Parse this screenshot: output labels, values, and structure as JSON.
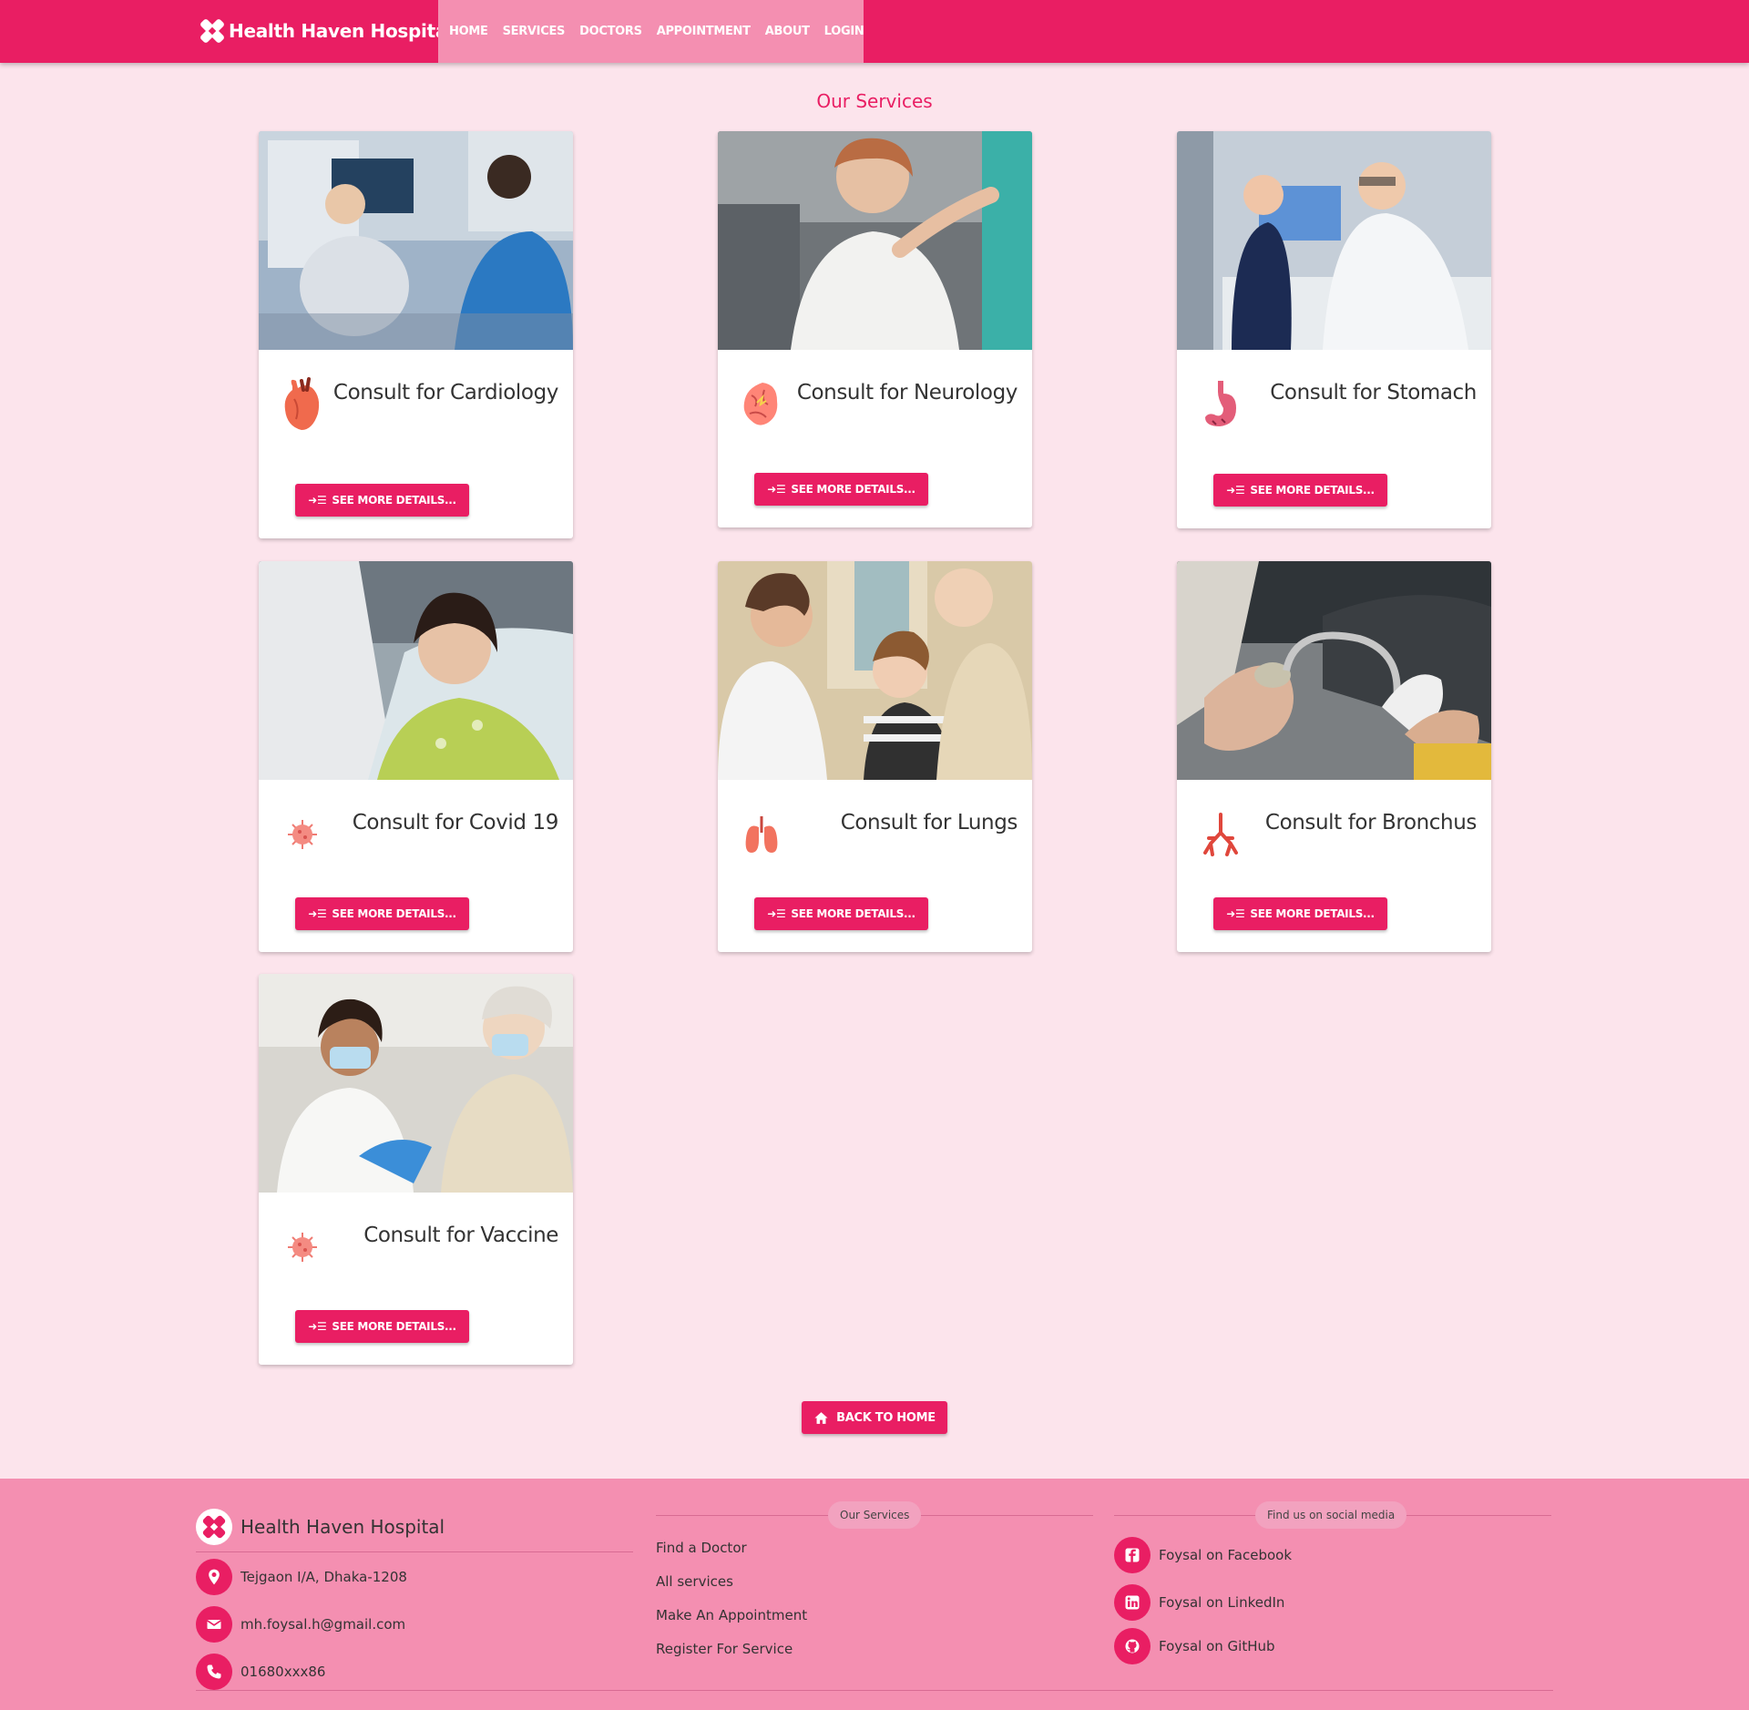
{
  "header": {
    "brand": "Health Haven Hospital",
    "nav": [
      "HOME",
      "SERVICES",
      "DOCTORS",
      "APPOINTMENT",
      "ABOUT",
      "LOGIN"
    ]
  },
  "page": {
    "title": "Our Services"
  },
  "services": [
    {
      "title": "Consult for Cardiology",
      "icon": "heart-icon",
      "button": "SEE MORE DETAILS..."
    },
    {
      "title": "Consult for Neurology",
      "icon": "brain-icon",
      "button": "SEE MORE DETAILS..."
    },
    {
      "title": "Consult for Stomach",
      "icon": "stomach-icon",
      "button": "SEE MORE DETAILS..."
    },
    {
      "title": "Consult for Covid 19",
      "icon": "virus-icon",
      "button": "SEE MORE DETAILS..."
    },
    {
      "title": "Consult for Lungs",
      "icon": "lungs-icon",
      "button": "SEE MORE DETAILS..."
    },
    {
      "title": "Consult for Bronchus",
      "icon": "bronchus-icon",
      "button": "SEE MORE DETAILS..."
    },
    {
      "title": "Consult for Vaccine",
      "icon": "virus-icon",
      "button": "SEE MORE DETAILS..."
    }
  ],
  "back_button": "BACK TO HOME",
  "footer": {
    "brand": "Health Haven Hospital",
    "address": "Tejgaon I/A, Dhaka-1208",
    "email": "mh.foysal.h@gmail.com",
    "phone": "01680xxx86",
    "services_heading": "Our Services",
    "services_links": [
      "Find a Doctor",
      "All services",
      "Make An Appointment",
      "Register For Service"
    ],
    "social_heading": "Find us on social media",
    "social_links": [
      "Foysal on Facebook",
      "Foysal on LinkedIn",
      "Foysal on GitHub"
    ]
  },
  "colors": {
    "primary": "#e91e63",
    "nav_bg": "#f48fb1",
    "page_bg": "#fce4ec",
    "footer_bg": "#f48fb1"
  }
}
